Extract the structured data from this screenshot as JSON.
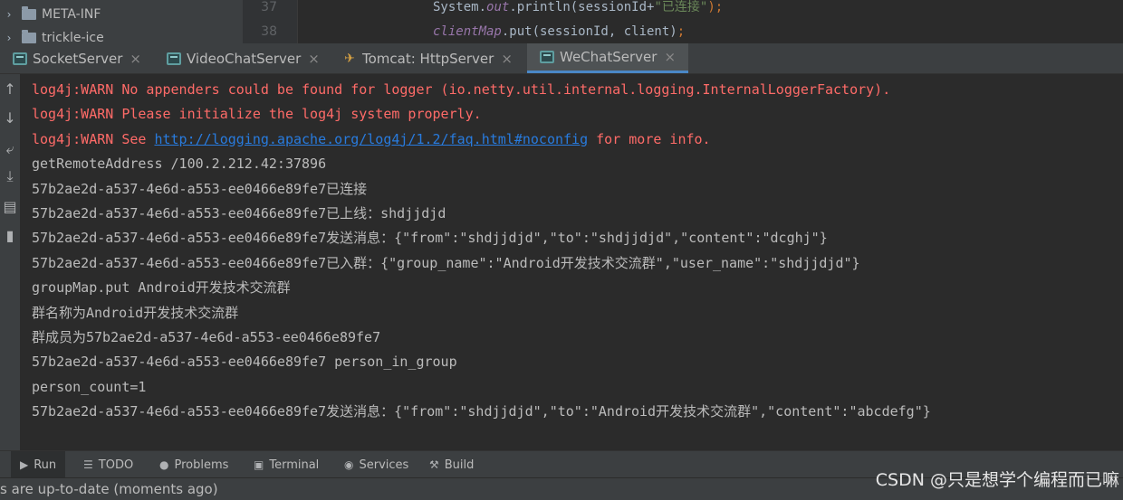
{
  "project_tree": {
    "items": [
      {
        "arrow": "›",
        "label": "META-INF"
      },
      {
        "arrow": "›",
        "label": "trickle-ice"
      }
    ]
  },
  "editor": {
    "lines": [
      {
        "number": "37",
        "segments": [
          {
            "text": "System.",
            "style": "default"
          },
          {
            "text": "out",
            "style": "field"
          },
          {
            "text": ".println(sessionId+",
            "style": "default"
          },
          {
            "text": "\"已连接\"",
            "style": "string"
          },
          {
            "text": ");",
            "style": "punct"
          }
        ]
      },
      {
        "number": "38",
        "segments": [
          {
            "text": "clientMap",
            "style": "field"
          },
          {
            "text": ".put(sessionId, client)",
            "style": "default"
          },
          {
            "text": ";",
            "style": "punct"
          }
        ]
      }
    ]
  },
  "run_tabs": [
    {
      "label": "SocketServer",
      "icon": "console-icon",
      "active": false
    },
    {
      "label": "VideoChatServer",
      "icon": "console-icon",
      "active": false
    },
    {
      "label": "Tomcat: HttpServer",
      "icon": "tomcat-icon",
      "active": false
    },
    {
      "label": "WeChatServer",
      "icon": "console-icon",
      "active": true
    }
  ],
  "close_glyph": "×",
  "left_tools": [
    {
      "name": "scroll-up-icon",
      "glyph": "↑"
    },
    {
      "name": "scroll-down-icon",
      "glyph": "↓"
    },
    {
      "name": "soft-wrap-icon",
      "glyph": "⤶"
    },
    {
      "name": "scroll-to-end-icon",
      "glyph": "⤓"
    },
    {
      "name": "print-icon",
      "glyph": "▤"
    },
    {
      "name": "clear-all-icon",
      "glyph": "▮"
    }
  ],
  "console": {
    "lines": [
      {
        "style": "warn",
        "segments": [
          {
            "text": "log4j:WARN No appenders could be found for logger (io.netty.util.internal.logging.InternalLoggerFactory)."
          }
        ]
      },
      {
        "style": "warn",
        "segments": [
          {
            "text": "log4j:WARN Please initialize the log4j system properly."
          }
        ]
      },
      {
        "style": "warn",
        "segments": [
          {
            "text": "log4j:WARN See "
          },
          {
            "text": "http://logging.apache.org/log4j/1.2/faq.html#noconfig",
            "link": true
          },
          {
            "text": " for more info."
          }
        ]
      },
      {
        "style": "normal",
        "segments": [
          {
            "text": "getRemoteAddress /100.2.212.42:37896"
          }
        ]
      },
      {
        "style": "normal",
        "segments": [
          {
            "text": "57b2ae2d-a537-4e6d-a553-ee0466e89fe7已连接"
          }
        ]
      },
      {
        "style": "normal",
        "segments": [
          {
            "text": "57b2ae2d-a537-4e6d-a553-ee0466e89fe7已上线：shdjjdjd"
          }
        ]
      },
      {
        "style": "normal",
        "segments": [
          {
            "text": "57b2ae2d-a537-4e6d-a553-ee0466e89fe7发送消息：{\"from\":\"shdjjdjd\",\"to\":\"shdjjdjd\",\"content\":\"dcghj\"}"
          }
        ]
      },
      {
        "style": "normal",
        "segments": [
          {
            "text": "57b2ae2d-a537-4e6d-a553-ee0466e89fe7已入群：{\"group_name\":\"Android开发技术交流群\",\"user_name\":\"shdjjdjd\"}"
          }
        ]
      },
      {
        "style": "normal",
        "segments": [
          {
            "text": "groupMap.put Android开发技术交流群"
          }
        ]
      },
      {
        "style": "normal",
        "segments": [
          {
            "text": "群名称为Android开发技术交流群"
          }
        ]
      },
      {
        "style": "normal",
        "segments": [
          {
            "text": "群成员为57b2ae2d-a537-4e6d-a553-ee0466e89fe7"
          }
        ]
      },
      {
        "style": "normal",
        "segments": [
          {
            "text": "57b2ae2d-a537-4e6d-a553-ee0466e89fe7 person_in_group"
          }
        ]
      },
      {
        "style": "normal",
        "segments": [
          {
            "text": "person_count=1"
          }
        ]
      },
      {
        "style": "normal",
        "segments": [
          {
            "text": "57b2ae2d-a537-4e6d-a553-ee0466e89fe7发送消息：{\"from\":\"shdjjdjd\",\"to\":\"Android开发技术交流群\",\"content\":\"abcdefg\"}"
          }
        ]
      }
    ]
  },
  "bottom_tabs": [
    {
      "label": "Run",
      "icon": "run-icon",
      "glyph": "▶",
      "active": true
    },
    {
      "label": "TODO",
      "icon": "todo-icon",
      "glyph": "☰",
      "active": false
    },
    {
      "label": "Problems",
      "icon": "problems-icon",
      "glyph": "●",
      "active": false
    },
    {
      "label": "Terminal",
      "icon": "terminal-icon",
      "glyph": "▣",
      "active": false
    },
    {
      "label": "Services",
      "icon": "services-icon",
      "glyph": "◉",
      "active": false
    },
    {
      "label": "Build",
      "icon": "build-icon",
      "glyph": "⚒",
      "active": false
    }
  ],
  "status": {
    "text": "s are up-to-date (moments ago)"
  },
  "watermark": "CSDN @只是想学个编程而已嘛",
  "colors": {
    "warn": "#ff6b68",
    "link": "#287bde",
    "accent": "#4a88c7"
  }
}
